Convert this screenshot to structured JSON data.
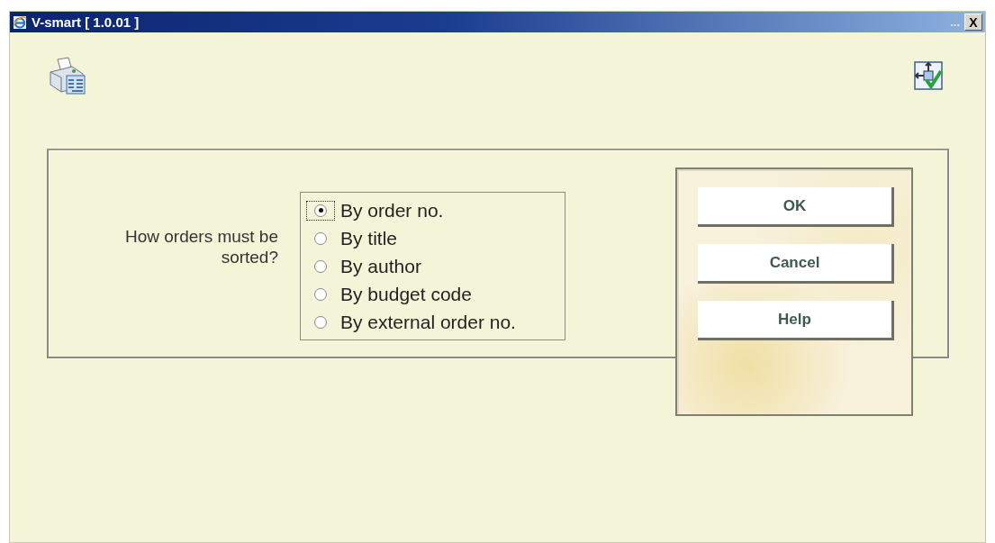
{
  "window": {
    "title": "V-smart [ 1.0.01 ]",
    "overflow": "...",
    "close": "X"
  },
  "form": {
    "label": "How orders must be sorted?",
    "options": [
      {
        "label": "By order no.",
        "selected": true
      },
      {
        "label": "By title",
        "selected": false
      },
      {
        "label": "By author",
        "selected": false
      },
      {
        "label": "By budget code",
        "selected": false
      },
      {
        "label": "By external order no.",
        "selected": false
      }
    ]
  },
  "buttons": [
    "OK",
    "Cancel",
    "Help"
  ]
}
